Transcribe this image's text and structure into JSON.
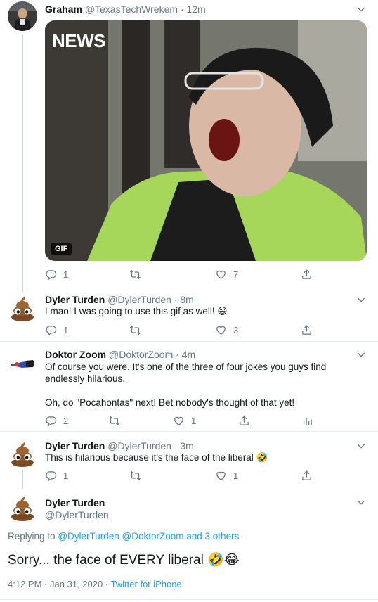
{
  "tweets": [
    {
      "name": "Graham",
      "handle": "@TexasTechWrekem",
      "time": "12m",
      "media": {
        "badge": "GIF",
        "overlay_text": "NEWS"
      },
      "reply_count": "1",
      "retweet_count": "",
      "like_count": "7"
    },
    {
      "name": "Dyler Turden",
      "handle": "@DylerTurden",
      "time": "8m",
      "text": "Lmao! I was going to use this gif as well! 😄",
      "reply_count": "1",
      "retweet_count": "",
      "like_count": "3"
    },
    {
      "name": "Doktor Zoom",
      "handle": "@DoktorZoom",
      "time": "4m",
      "text": "Of course you were. It's one of the three of four jokes you guys find endlessly hilarious.\n\nOh, do \"Pocahontas\" next! Bet nobody's thought of that yet!",
      "reply_count": "2",
      "retweet_count": "",
      "like_count": "1"
    },
    {
      "name": "Dyler Turden",
      "handle": "@DylerTurden",
      "time": "3m",
      "text": "This is hilarious because it's the face of the liberal 🤣",
      "reply_count": "1",
      "retweet_count": "",
      "like_count": "1"
    }
  ],
  "dot": "·",
  "main_tweet": {
    "name": "Dyler Turden",
    "handle": "@DylerTurden",
    "replying_prefix": "Replying to",
    "replying_to": "@DylerTurden @DoktorZoom and 3 others",
    "text": "Sorry... the face of EVERY liberal 🤣😂",
    "time": "4:12 PM",
    "date": "Jan 31, 2020",
    "client": "Twitter for iPhone"
  },
  "colors": {
    "link": "#1da1f2",
    "muted": "#657786",
    "thread_line": "#ccd6dd"
  },
  "icons": [
    "reply-icon",
    "retweet-icon",
    "like-icon",
    "share-icon",
    "analytics-icon",
    "chevron-down-icon"
  ]
}
